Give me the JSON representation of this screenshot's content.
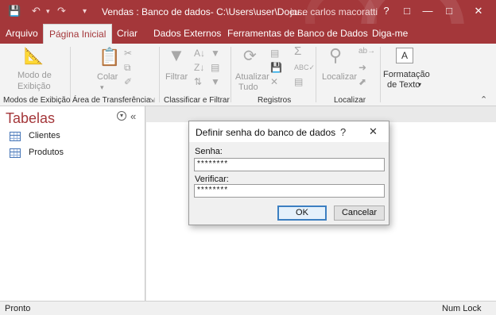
{
  "window": {
    "title": "Vendas : Banco de dados- C:\\Users\\user\\Docu...",
    "user": "jose carlos macoratti",
    "help": "?",
    "accent": "#a4373a"
  },
  "tabs": [
    {
      "label": "Arquivo"
    },
    {
      "label": "Página Inicial"
    },
    {
      "label": "Criar"
    },
    {
      "label": "Dados Externos"
    },
    {
      "label": "Ferramentas de Banco de Dados"
    },
    {
      "label": "Diga-me"
    }
  ],
  "ribbon": {
    "modo_line1": "Modo de",
    "modo_line2": "Exibição",
    "colar": "Colar",
    "filtrar": "Filtrar",
    "atualizar_line1": "Atualizar",
    "atualizar_line2": "Tudo",
    "localizar": "Localizar",
    "formatacao_line1": "Formatação",
    "formatacao_line2": "de Texto",
    "groups": [
      {
        "label": "Modos de Exibição"
      },
      {
        "label": "Área de Transferência"
      },
      {
        "label": "Classificar e Filtrar"
      },
      {
        "label": "Registros"
      },
      {
        "label": "Localizar"
      }
    ]
  },
  "nav": {
    "title": "Tabelas",
    "items": [
      {
        "label": "Clientes",
        "icon": "table-icon"
      },
      {
        "label": "Produtos",
        "icon": "table-icon"
      }
    ]
  },
  "dialog": {
    "title": "Definir senha do banco de dados",
    "help": "?",
    "senha_label": "Senha:",
    "senha_value": "********",
    "verificar_label": "Verificar:",
    "verificar_value": "********",
    "ok": "OK",
    "cancel": "Cancelar"
  },
  "status": {
    "left": "Pronto",
    "right": "Num Lock"
  }
}
